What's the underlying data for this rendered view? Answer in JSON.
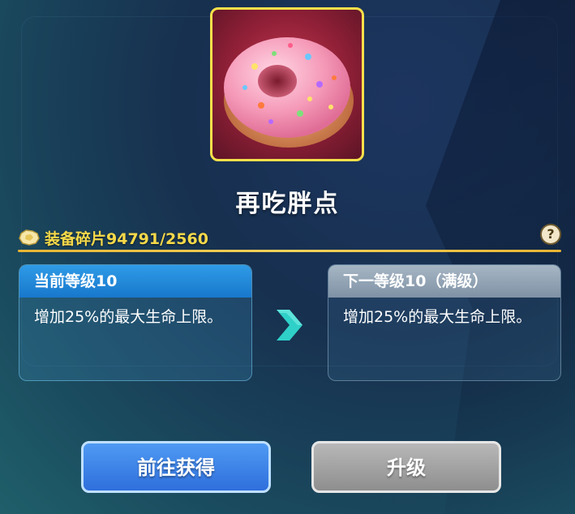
{
  "item": {
    "name": "再吃胖点",
    "icon": "pink-donut-icon"
  },
  "fragments": {
    "label": "装备碎片94791/2560",
    "icon": "fragment-icon"
  },
  "help": {
    "label": "?"
  },
  "current_level": {
    "title": "当前等级10",
    "description": "增加25%的最大生命上限。"
  },
  "next_level": {
    "title": "下一等级10（满级）",
    "description": "增加25%的最大生命上限。"
  },
  "buttons": {
    "go_obtain": "前往获得",
    "upgrade": "升级"
  },
  "colors": {
    "accent_gold": "#f5d94a",
    "current_header": "#1878cc",
    "next_header": "#7f92a5",
    "primary_button": "#2f6fdc",
    "disabled_button": "#8e8e8e"
  }
}
